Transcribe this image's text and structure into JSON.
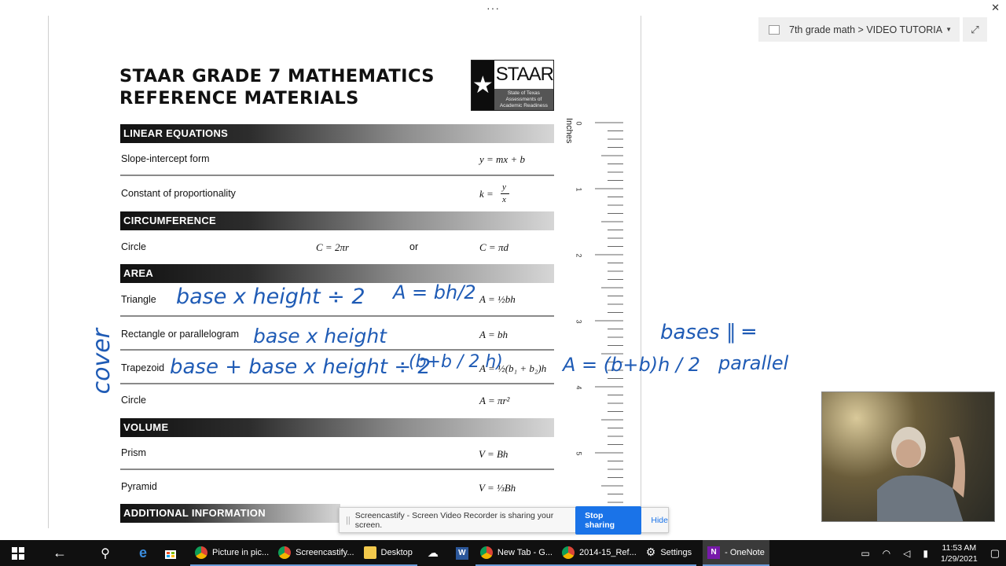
{
  "window": {
    "menu_dots": "···",
    "close_glyph": "✕"
  },
  "onenote": {
    "breadcrumb": "7th grade math > VIDEO TUTORIA",
    "expand_glyph": "⤢"
  },
  "sheet": {
    "title_line1": "STAAR GRADE 7 MATHEMATICS",
    "title_line2": "REFERENCE MATERIALS",
    "logo_word": "STAAR",
    "logo_sub": "State of Texas Assessments of Academic Readiness"
  },
  "sections": {
    "linear": {
      "header": "LINEAR EQUATIONS",
      "slope_label": "Slope-intercept form",
      "slope_formula": "y = mx + b",
      "prop_label": "Constant of proportionality",
      "prop_formula_left": "k =",
      "prop_num": "y",
      "prop_den": "x"
    },
    "circumference": {
      "header": "CIRCUMFERENCE",
      "label": "Circle",
      "formula_a": "C = 2πr",
      "or": "or",
      "formula_b": "C = πd"
    },
    "area": {
      "header": "AREA",
      "triangle_label": "Triangle",
      "triangle_formula": "A = ½bh",
      "rect_label": "Rectangle or parallelogram",
      "rect_formula": "A = bh",
      "trap_label": "Trapezoid",
      "trap_formula": "A = ½(b₁ + b₂)h",
      "circle_label": "Circle",
      "circle_formula": "A = πr²"
    },
    "volume": {
      "header": "VOLUME",
      "prism_label": "Prism",
      "prism_formula": "V = Bh",
      "pyramid_label": "Pyramid",
      "pyramid_formula": "V = ⅓Bh"
    },
    "additional": {
      "header": "ADDITIONAL INFORMATION"
    }
  },
  "ruler": {
    "label": "Inches",
    "numbers": [
      "0",
      "1",
      "2",
      "3",
      "4",
      "5"
    ]
  },
  "ink": {
    "triangle_note": "base x height ÷ 2",
    "triangle_formula": "A = bh/2",
    "rect_note": "base x height",
    "trap_note": "base + base x height ÷ 2",
    "trap_paren": "(b+b / 2 h)",
    "side_formula": "A = (b+b)h / 2",
    "cover": "cover",
    "bases_note": "bases ∥ ═",
    "parallel_note": "parallel"
  },
  "share_bar": {
    "message": "Screencastify - Screen Video Recorder is sharing your screen.",
    "stop_label": "Stop sharing",
    "hide_label": "Hide"
  },
  "taskbar": {
    "apps": [
      {
        "label": "Picture in pic...",
        "color": "#e0b020"
      },
      {
        "label": "Screencastify...",
        "color": "#e0b020"
      },
      {
        "label": "Desktop",
        "color": "#f2c94c"
      },
      {
        "label": "New Tab - G...",
        "color": "#e0b020"
      },
      {
        "label": "2014-15_Ref...",
        "color": "#e0b020"
      },
      {
        "label": "Settings",
        "color": "#ffffff"
      },
      {
        "label": "- OneNote",
        "color": "#8e44ad"
      }
    ],
    "time": "11:53 AM",
    "date": "1/29/2021"
  }
}
